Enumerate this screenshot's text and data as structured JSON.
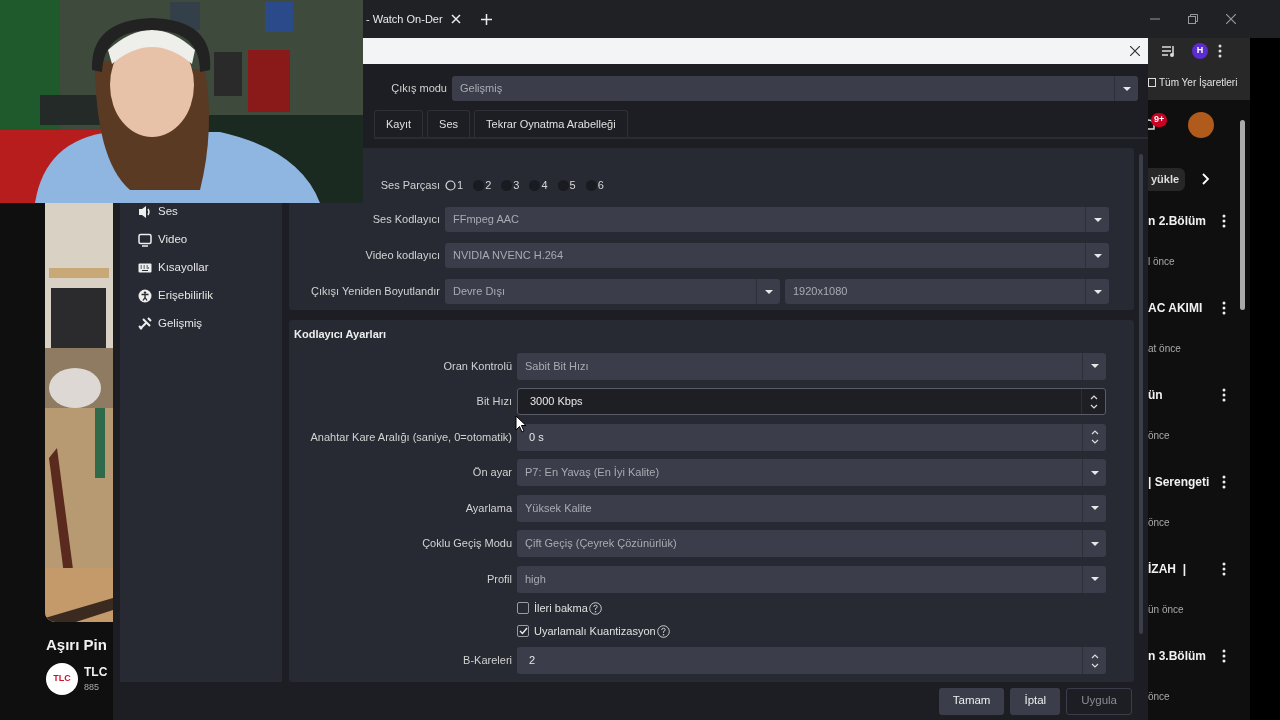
{
  "browser": {
    "tab_title": "- Watch On-Der",
    "bookmarks": "Tüm Yer İşaretleri",
    "notification_count": "9+",
    "profile_initial": "H",
    "chip": "yükle"
  },
  "left_video": {
    "title": "Aşırı Pin",
    "channel_logo": "TLC",
    "channel": "TLC",
    "views": "885"
  },
  "right_feed": [
    {
      "kind": "title",
      "text": "n 2.Bölüm"
    },
    {
      "kind": "meta",
      "text": "l önce"
    },
    {
      "kind": "title",
      "text": "AC AKIMI"
    },
    {
      "kind": "meta",
      "text": "at önce"
    },
    {
      "kind": "title",
      "text": "ün"
    },
    {
      "kind": "meta",
      "text": "önce"
    },
    {
      "kind": "title",
      "text": "| Serengeti"
    },
    {
      "kind": "meta",
      "text": "önce"
    },
    {
      "kind": "title",
      "text": "İZAH  |"
    },
    {
      "kind": "meta",
      "text": "ün önce"
    },
    {
      "kind": "title",
      "text": "n 3.Bölüm"
    },
    {
      "kind": "meta",
      "text": "önce"
    }
  ],
  "dialog": {
    "sidebar": [
      {
        "kind": "speaker",
        "label": "Ses"
      },
      {
        "kind": "monitor",
        "label": "Video"
      },
      {
        "kind": "keyboard",
        "label": "Kısayollar"
      },
      {
        "kind": "accessibility",
        "label": "Erişebilirlik"
      },
      {
        "kind": "tools",
        "label": "Gelişmiş"
      }
    ],
    "output_mode": {
      "label": "Çıkış modu",
      "value": "Gelişmiş"
    },
    "tabs": [
      {
        "label": "Kayıt",
        "selected": false
      },
      {
        "label": "Ses",
        "selected": false
      },
      {
        "label": "Tekrar Oynatma Arabelleği",
        "selected": false
      }
    ],
    "audio_track": {
      "label": "Ses Parçası",
      "options": [
        {
          "label": "1",
          "selected": true
        },
        {
          "label": "2",
          "selected": false
        },
        {
          "label": "3",
          "selected": false
        },
        {
          "label": "4",
          "selected": false
        },
        {
          "label": "5",
          "selected": false
        },
        {
          "label": "6",
          "selected": false
        }
      ]
    },
    "general_rows": [
      {
        "kind": "select",
        "label": "Ses Kodlayıcı",
        "value": "FFmpeg AAC"
      },
      {
        "kind": "select",
        "label": "Video kodlayıcı",
        "value": "NVIDIA NVENC H.264"
      },
      {
        "kind": "pair",
        "label": "Çıkışı Yeniden Boyutlandır",
        "value": "Devre Dışı",
        "value_2": "1920x1080"
      }
    ],
    "encoder_section": {
      "title": "Kodlayıcı Ayarları",
      "rows": [
        {
          "kind": "select",
          "label": "Oran Kontrolü",
          "value": "Sabit Bit Hızı"
        },
        {
          "kind": "spin",
          "label": "Bit Hızı",
          "value": "3000 Kbps",
          "focused": true
        },
        {
          "kind": "spin",
          "label": "Anahtar Kare Aralığı (saniye, 0=otomatik)",
          "value": "0 s",
          "focused": false
        },
        {
          "kind": "select",
          "label": "Ön ayar",
          "value": "P7: En Yavaş (En İyi Kalite)"
        },
        {
          "kind": "select",
          "label": "Ayarlama",
          "value": "Yüksek Kalite"
        },
        {
          "kind": "select",
          "label": "Çoklu Geçiş Modu",
          "value": "Çift Geçiş (Çeyrek Çözünürlük)"
        },
        {
          "kind": "select",
          "label": "Profil",
          "value": "high"
        },
        {
          "kind": "checkbox",
          "label": "İleri bakma",
          "checked": false
        },
        {
          "kind": "checkbox",
          "label": "Uyarlamalı Kuantizasyon",
          "checked": true
        },
        {
          "kind": "spin",
          "label": "B-Kareleri",
          "value": "2",
          "focused": false
        }
      ]
    },
    "buttons": [
      {
        "label": "Tamam",
        "disabled": false
      },
      {
        "label": "İptal",
        "disabled": false
      },
      {
        "label": "Uygula",
        "disabled": true
      }
    ]
  }
}
